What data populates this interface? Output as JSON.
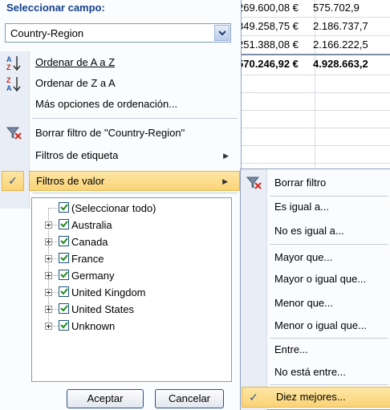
{
  "sheet": {
    "rows": [
      {
        "c1": "269.600,08 €",
        "c2": "575.702,9"
      },
      {
        "c1": "349.258,75 €",
        "c2": "2.186.737,7"
      },
      {
        "c1": "251.388,08 €",
        "c2": "2.166.222,5"
      },
      {
        "c1": "570.246,92 €",
        "c2": "4.928.663,2"
      }
    ]
  },
  "filter_menu": {
    "header": "Seleccionar campo:",
    "field_combo": {
      "value": "Country-Region"
    },
    "items": {
      "sort_az": "Ordenar de A a Z",
      "sort_za": "Ordenar de Z a A",
      "more_sort": "Más opciones de ordenación...",
      "clear_filter": "Borrar filtro de \"Country-Region\"",
      "label_filters": "Filtros de etiqueta",
      "value_filters": "Filtros de valor"
    },
    "list": {
      "select_all": "(Seleccionar todo)",
      "countries": [
        "Australia",
        "Canada",
        "France",
        "Germany",
        "United Kingdom",
        "United States",
        "Unknown"
      ]
    },
    "ok_label": "Aceptar",
    "cancel_label": "Cancelar",
    "check_mark": "✓"
  },
  "value_submenu": {
    "clear": "Borrar filtro",
    "items": [
      "Es igual a...",
      "No es igual a...",
      "Mayor que...",
      "Mayor o igual que...",
      "Menor que...",
      "Menor o igual que...",
      "Entre...",
      "No está entre...",
      "Diez mejores..."
    ],
    "check_mark": "✓"
  },
  "colors": {
    "highlight": "#fbd376",
    "accent": "#15428b"
  }
}
